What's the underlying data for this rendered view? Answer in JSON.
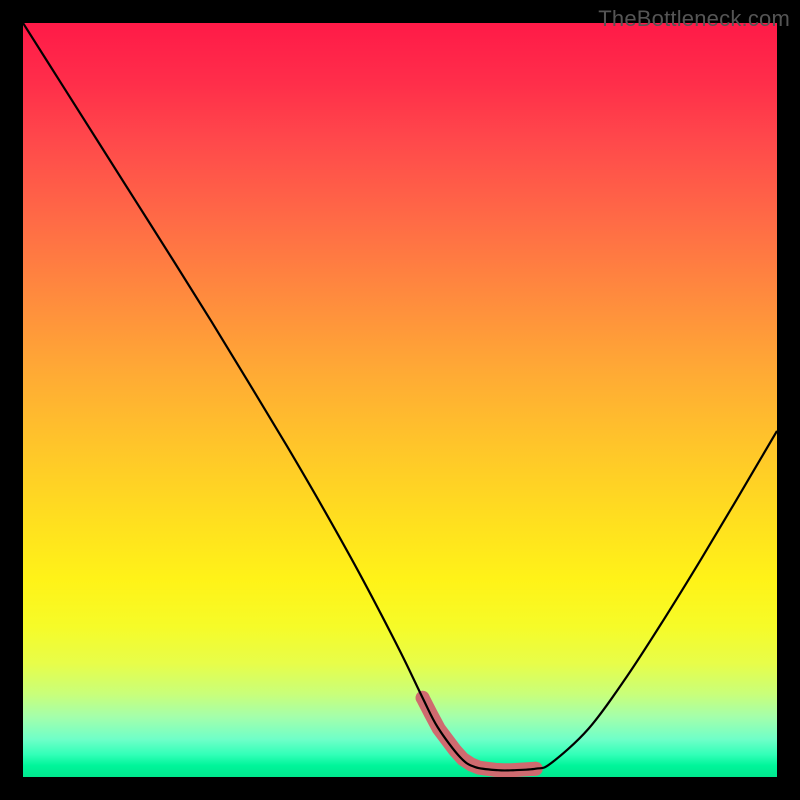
{
  "watermark": "TheBottleneck.com",
  "chart_data": {
    "type": "line",
    "title": "",
    "xlabel": "",
    "ylabel": "",
    "xlim": [
      0,
      100
    ],
    "ylim": [
      0,
      100
    ],
    "grid": false,
    "legend": false,
    "series": [
      {
        "name": "bottleneck-curve",
        "x": [
          0,
          5,
          10,
          15,
          20,
          25,
          30,
          35,
          40,
          45,
          50,
          53,
          55,
          58,
          60,
          63,
          65,
          68,
          70,
          75,
          80,
          85,
          90,
          95,
          100
        ],
        "y": [
          100,
          92.1,
          84.2,
          76.3,
          68.4,
          60.4,
          52.2,
          43.9,
          35.3,
          26.3,
          16.7,
          10.5,
          6.6,
          2.6,
          1.3,
          0.9,
          0.9,
          1.1,
          1.8,
          6.4,
          13.2,
          20.9,
          29.0,
          37.4,
          45.9
        ]
      }
    ],
    "optimal_band": {
      "name": "optimal-zone",
      "x_start": 53,
      "x_end": 68,
      "y_level": 0.9
    },
    "gradient_stops": [
      {
        "pos": 0,
        "color": "#ff1a48"
      },
      {
        "pos": 50,
        "color": "#ffc52a"
      },
      {
        "pos": 80,
        "color": "#f6fb28"
      },
      {
        "pos": 100,
        "color": "#00e78e"
      }
    ]
  }
}
